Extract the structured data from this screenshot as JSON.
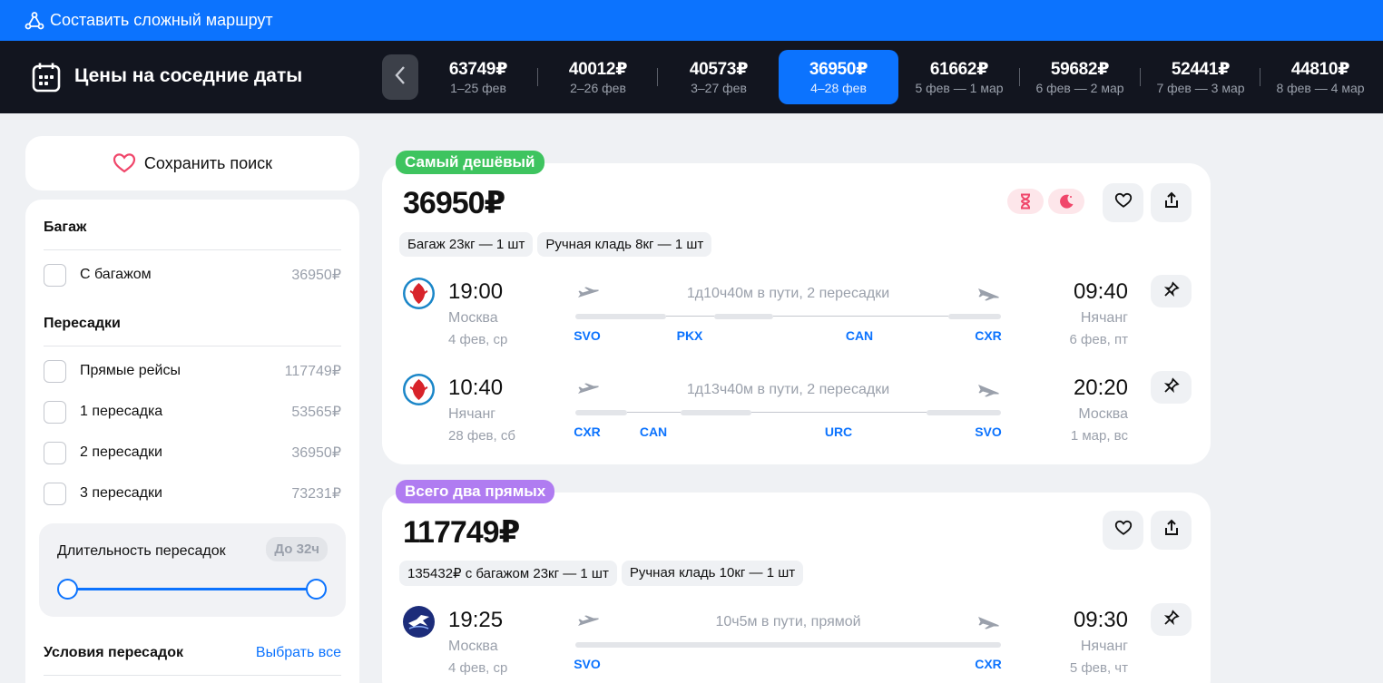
{
  "top_bar": {
    "label": "Составить сложный маршрут"
  },
  "dates_bar": {
    "title": "Цены на соседние даты",
    "dates": [
      {
        "price": "63749₽",
        "range": "1–25 фев"
      },
      {
        "price": "40012₽",
        "range": "2–26 фев"
      },
      {
        "price": "40573₽",
        "range": "3–27 фев"
      },
      {
        "price": "36950₽",
        "range": "4–28 фев",
        "active": true
      },
      {
        "price": "61662₽",
        "range": "5 фев — 1 мар"
      },
      {
        "price": "59682₽",
        "range": "6 фев — 2 мар"
      },
      {
        "price": "52441₽",
        "range": "7 фев — 3 мар"
      },
      {
        "price": "44810₽",
        "range": "8 фев — 4 мар"
      }
    ]
  },
  "sidebar": {
    "save_label": "Сохранить поиск",
    "baggage": {
      "title": "Багаж",
      "options": [
        {
          "label": "С багажом",
          "price": "36950₽"
        }
      ]
    },
    "transfers": {
      "title": "Пересадки",
      "options": [
        {
          "label": "Прямые рейсы",
          "price": "117749₽"
        },
        {
          "label": "1 пересадка",
          "price": "53565₽"
        },
        {
          "label": "2 пересадки",
          "price": "36950₽"
        },
        {
          "label": "3 пересадки",
          "price": "73231₽"
        }
      ]
    },
    "duration": {
      "label": "Длительность пересадок",
      "badge": "До 32ч"
    },
    "conditions": {
      "title": "Условия пересадок",
      "action": "Выбрать все"
    }
  },
  "tickets": [
    {
      "tag": "Самый дешёвый",
      "price": "36950₽",
      "chips": [
        "Багаж 23кг — 1 шт",
        "Ручная кладь 8кг — 1 шт"
      ],
      "segments": [
        {
          "dep_time": "19:00",
          "dep_city": "Москва",
          "dep_date": "4 фев, ср",
          "duration": "1д10ч40м в пути, 2 пересадки",
          "arr_time": "09:40",
          "arr_city": "Нячанг",
          "arr_date": "6 фев, пт",
          "codes": [
            "SVO",
            "PKX",
            "CAN",
            "CXR"
          ]
        },
        {
          "dep_time": "10:40",
          "dep_city": "Нячанг",
          "dep_date": "28 фев, сб",
          "duration": "1д13ч40м в пути, 2 пересадки",
          "arr_time": "20:20",
          "arr_city": "Москва",
          "arr_date": "1 мар, вс",
          "codes": [
            "CXR",
            "CAN",
            "URC",
            "SVO"
          ]
        }
      ]
    },
    {
      "tag": "Всего два прямых",
      "price": "117749₽",
      "chips": [
        "135432₽ с багажом 23кг — 1 шт",
        "Ручная кладь 10кг — 1 шт"
      ],
      "segments": [
        {
          "dep_time": "19:25",
          "dep_city": "Москва",
          "dep_date": "4 фев, ср",
          "duration": "10ч5м в пути, прямой",
          "arr_time": "09:30",
          "arr_city": "Нячанг",
          "arr_date": "5 фев, чт",
          "codes": [
            "SVO",
            "CXR"
          ]
        }
      ]
    }
  ],
  "colors": {
    "accent": "#0c73fe",
    "cheapest_tag": "#3ec45f",
    "direct_tag": "#b07cf1",
    "dark_bar": "#12151f"
  },
  "icons": [
    "route-icon",
    "calendar-icon",
    "chevron-left-icon",
    "heart-icon",
    "hourglass-icon",
    "night-icon",
    "share-icon",
    "pin-icon",
    "takeoff-icon",
    "landing-icon",
    "airline-logo-icon"
  ]
}
